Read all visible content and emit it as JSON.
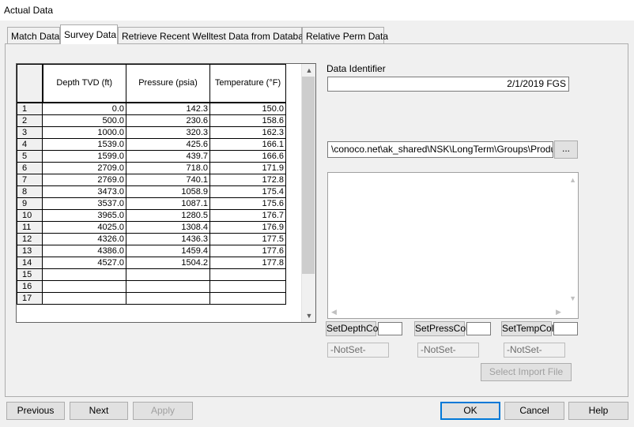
{
  "window": {
    "title": "Actual Data"
  },
  "tabs": [
    {
      "label": "Match Data"
    },
    {
      "label": "Survey Data"
    },
    {
      "label": "Retrieve Recent Welltest Data from Databases"
    },
    {
      "label": "Relative Perm Data"
    }
  ],
  "grid": {
    "columns": [
      "Depth TVD (ft)",
      "Pressure (psia)",
      "Temperature (°F)"
    ],
    "rows": [
      {
        "n": "1",
        "depth": "0.0",
        "pressure": "142.3",
        "temp": "150.0"
      },
      {
        "n": "2",
        "depth": "500.0",
        "pressure": "230.6",
        "temp": "158.6"
      },
      {
        "n": "3",
        "depth": "1000.0",
        "pressure": "320.3",
        "temp": "162.3"
      },
      {
        "n": "4",
        "depth": "1539.0",
        "pressure": "425.6",
        "temp": "166.1"
      },
      {
        "n": "5",
        "depth": "1599.0",
        "pressure": "439.7",
        "temp": "166.6"
      },
      {
        "n": "6",
        "depth": "2709.0",
        "pressure": "718.0",
        "temp": "171.9"
      },
      {
        "n": "7",
        "depth": "2769.0",
        "pressure": "740.1",
        "temp": "172.8"
      },
      {
        "n": "8",
        "depth": "3473.0",
        "pressure": "1058.9",
        "temp": "175.4"
      },
      {
        "n": "9",
        "depth": "3537.0",
        "pressure": "1087.1",
        "temp": "175.6"
      },
      {
        "n": "10",
        "depth": "3965.0",
        "pressure": "1280.5",
        "temp": "176.7"
      },
      {
        "n": "11",
        "depth": "4025.0",
        "pressure": "1308.4",
        "temp": "176.9"
      },
      {
        "n": "12",
        "depth": "4326.0",
        "pressure": "1436.3",
        "temp": "177.5"
      },
      {
        "n": "13",
        "depth": "4386.0",
        "pressure": "1459.4",
        "temp": "177.6"
      },
      {
        "n": "14",
        "depth": "4527.0",
        "pressure": "1504.2",
        "temp": "177.8"
      },
      {
        "n": "15",
        "depth": "",
        "pressure": "",
        "temp": ""
      },
      {
        "n": "16",
        "depth": "",
        "pressure": "",
        "temp": ""
      },
      {
        "n": "17",
        "depth": "",
        "pressure": "",
        "temp": ""
      }
    ]
  },
  "data_identifier": {
    "label": "Data Identifier",
    "value": "2/1/2019 FGS"
  },
  "file_path": {
    "value": "\\conoco.net\\ak_shared\\NSK\\LongTerm\\Groups\\Production",
    "browse_label": "..."
  },
  "import": {
    "set_depth_col": "SetDepthCol",
    "set_press_col": "SetPressCol",
    "set_temp_col": "SetTempCol",
    "depth_status": "-NotSet-",
    "press_status": "-NotSet-",
    "temp_status": "-NotSet-",
    "select_import_file": "Select Import File"
  },
  "footer": {
    "previous": "Previous",
    "next": "Next",
    "apply": "Apply",
    "ok": "OK",
    "cancel": "Cancel",
    "help": "Help"
  }
}
